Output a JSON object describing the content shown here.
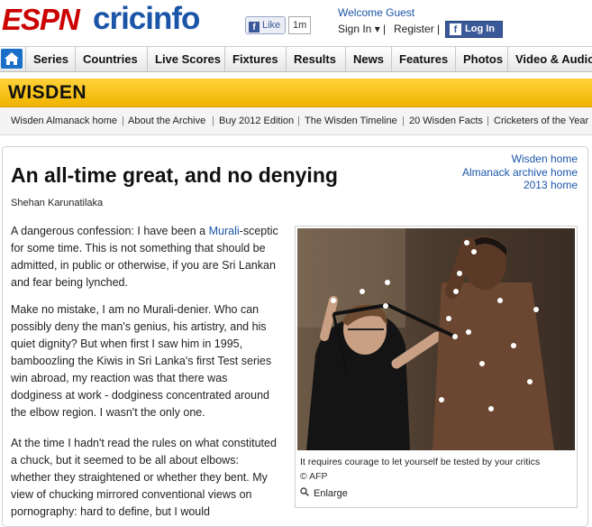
{
  "header": {
    "espn": "ESPN",
    "cricinfo": "cricinfo",
    "like_label": "Like",
    "like_count": "1m",
    "welcome": "Welcome Guest",
    "sign_in": "Sign In ▾ |",
    "register": "Register |",
    "login": "Log In"
  },
  "nav": {
    "items": [
      "Series",
      "Countries",
      "Live Scores",
      "Fixtures",
      "Results",
      "News",
      "Features",
      "Photos",
      "Video & Audio"
    ]
  },
  "wisden": {
    "title": "WISDEN",
    "subnav": [
      "Wisden Almanack home",
      "About the Archive",
      "Buy 2012 Edition",
      "The Wisden Timeline",
      "20 Wisden Facts",
      "Cricketers of the Year"
    ]
  },
  "article": {
    "title": "An all-time great, and no denying",
    "byline": "Shehan Karunatilaka",
    "side_links": [
      "Wisden home",
      "Almanack archive home",
      "2013 home"
    ],
    "p1_before": "A dangerous confession: I have been a ",
    "p1_link": "Murali",
    "p1_after": "-sceptic for some time. This is not something that should be admitted, in public or otherwise, if you are Sri Lankan and fear being lynched.",
    "p2": "Make no mistake, I am no Murali-denier. Who can possibly deny the man's genius, his artistry, and his quiet dignity? But when first I saw him in 1995, bamboozling the Kiwis in Sri Lanka's first Test series win abroad, my reaction was that there was dodginess at work - dodginess concentrated around the elbow region. I wasn't the only one.",
    "p3": "At the time I hadn't read the rules on what constituted a chuck, but it seemed to be all about elbows: whether they straightened or whether they bent. My view of chucking mirrored conventional views on pornography: hard to define, but I would"
  },
  "figure": {
    "caption": "It requires courage to let yourself be tested by your critics",
    "credit": "© AFP",
    "enlarge": "Enlarge"
  },
  "colors": {
    "espn_red": "#cc0000",
    "cricinfo_blue": "#1a55a8",
    "wisden_yellow": "#f6c20a",
    "facebook_blue": "#3b5998"
  }
}
